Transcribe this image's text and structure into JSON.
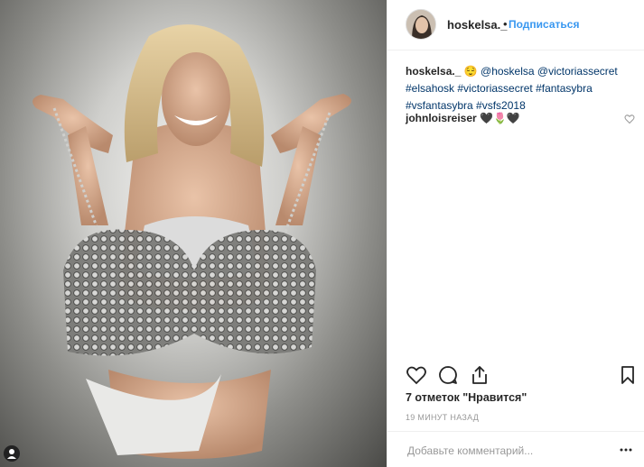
{
  "post": {
    "username": "hoskelsa._",
    "separator": "•",
    "follow_label": "Подписаться",
    "caption": {
      "username": "hoskelsa._",
      "emoji": "😌",
      "line1": "@hoskelsa @victoriassecret",
      "line2": "#elsahosk #victoriassecret #fantasybra",
      "line3": "#vsfantasybra #vsfs2018"
    },
    "comments": [
      {
        "username": "johnloisreiser",
        "text": "🖤🌷🖤"
      }
    ],
    "likes_label": "7 отметок \"Нравится\"",
    "time_label": "19 МИНУТ НАЗАД",
    "comment_placeholder": "Добавьте комментарий...",
    "icons": {
      "like": "heart-outline-icon",
      "comment": "speech-bubble-icon",
      "share": "share-icon",
      "save": "bookmark-icon",
      "more": "more-dots-icon",
      "comment_like": "heart-outline-icon-small",
      "media_badge": "person-badge-icon"
    },
    "colors": {
      "link": "#003569",
      "follow": "#3897f0",
      "muted": "#999999",
      "border": "#efefef"
    }
  }
}
